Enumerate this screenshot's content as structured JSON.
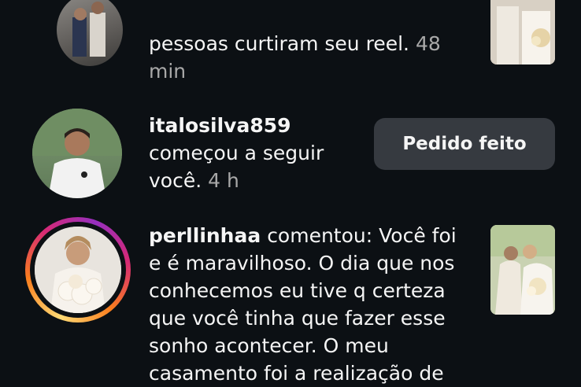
{
  "notifications": [
    {
      "text": "pessoas curtiram seu reel.",
      "time": "48",
      "time_line2": "min"
    },
    {
      "username": "italosilva859",
      "text_line1": "começou a seguir",
      "text_line2": "você.",
      "time": "4 h",
      "button_label": "Pedido feito"
    },
    {
      "username": "perllinhaa",
      "lines": [
        "comentou: Você foi",
        "e é maravilhoso. O dia que nos",
        "conhecemos eu tive q certeza",
        "que você tinha que fazer esse",
        "sonho acontecer. O meu",
        "casamento foi a realização de"
      ]
    }
  ],
  "colors": {
    "background": "#0c1014",
    "text": "#f5f5f5",
    "muted": "#a8a8a8",
    "button": "#363a40"
  }
}
